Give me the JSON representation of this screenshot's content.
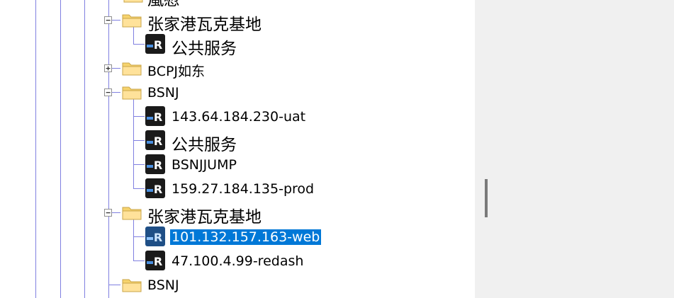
{
  "tree": {
    "truncated_top_label": "嵐慰",
    "items": [
      {
        "label": "张家港瓦克基地",
        "type": "group",
        "expander": "−"
      },
      {
        "label": "公共服务",
        "type": "server"
      },
      {
        "label": "BCPJ如东",
        "type": "group",
        "expander": "+"
      },
      {
        "label": "BSNJ",
        "type": "group",
        "expander": "−"
      },
      {
        "label": "143.64.184.230-uat",
        "type": "server"
      },
      {
        "label": "公共服务",
        "type": "server"
      },
      {
        "label": "BSNJJUMP",
        "type": "server"
      },
      {
        "label": "159.27.184.135-prod",
        "type": "server"
      },
      {
        "label": "张家港瓦克基地",
        "type": "group",
        "expander": "−"
      },
      {
        "label": "101.132.157.163-web",
        "type": "server",
        "selected": true
      },
      {
        "label": "47.100.4.99-redash",
        "type": "server"
      },
      {
        "label": "BSNJ",
        "type": "group"
      }
    ]
  },
  "icons": {
    "folder": "folder-icon",
    "server": "remote-server-icon",
    "server_badge": "R"
  },
  "colors": {
    "tree_line": "#8080e0",
    "selection": "#0078d7",
    "folder": "#f6d36d",
    "server_bg": "#1a1a1a",
    "right_pane": "#f0f0f0"
  }
}
